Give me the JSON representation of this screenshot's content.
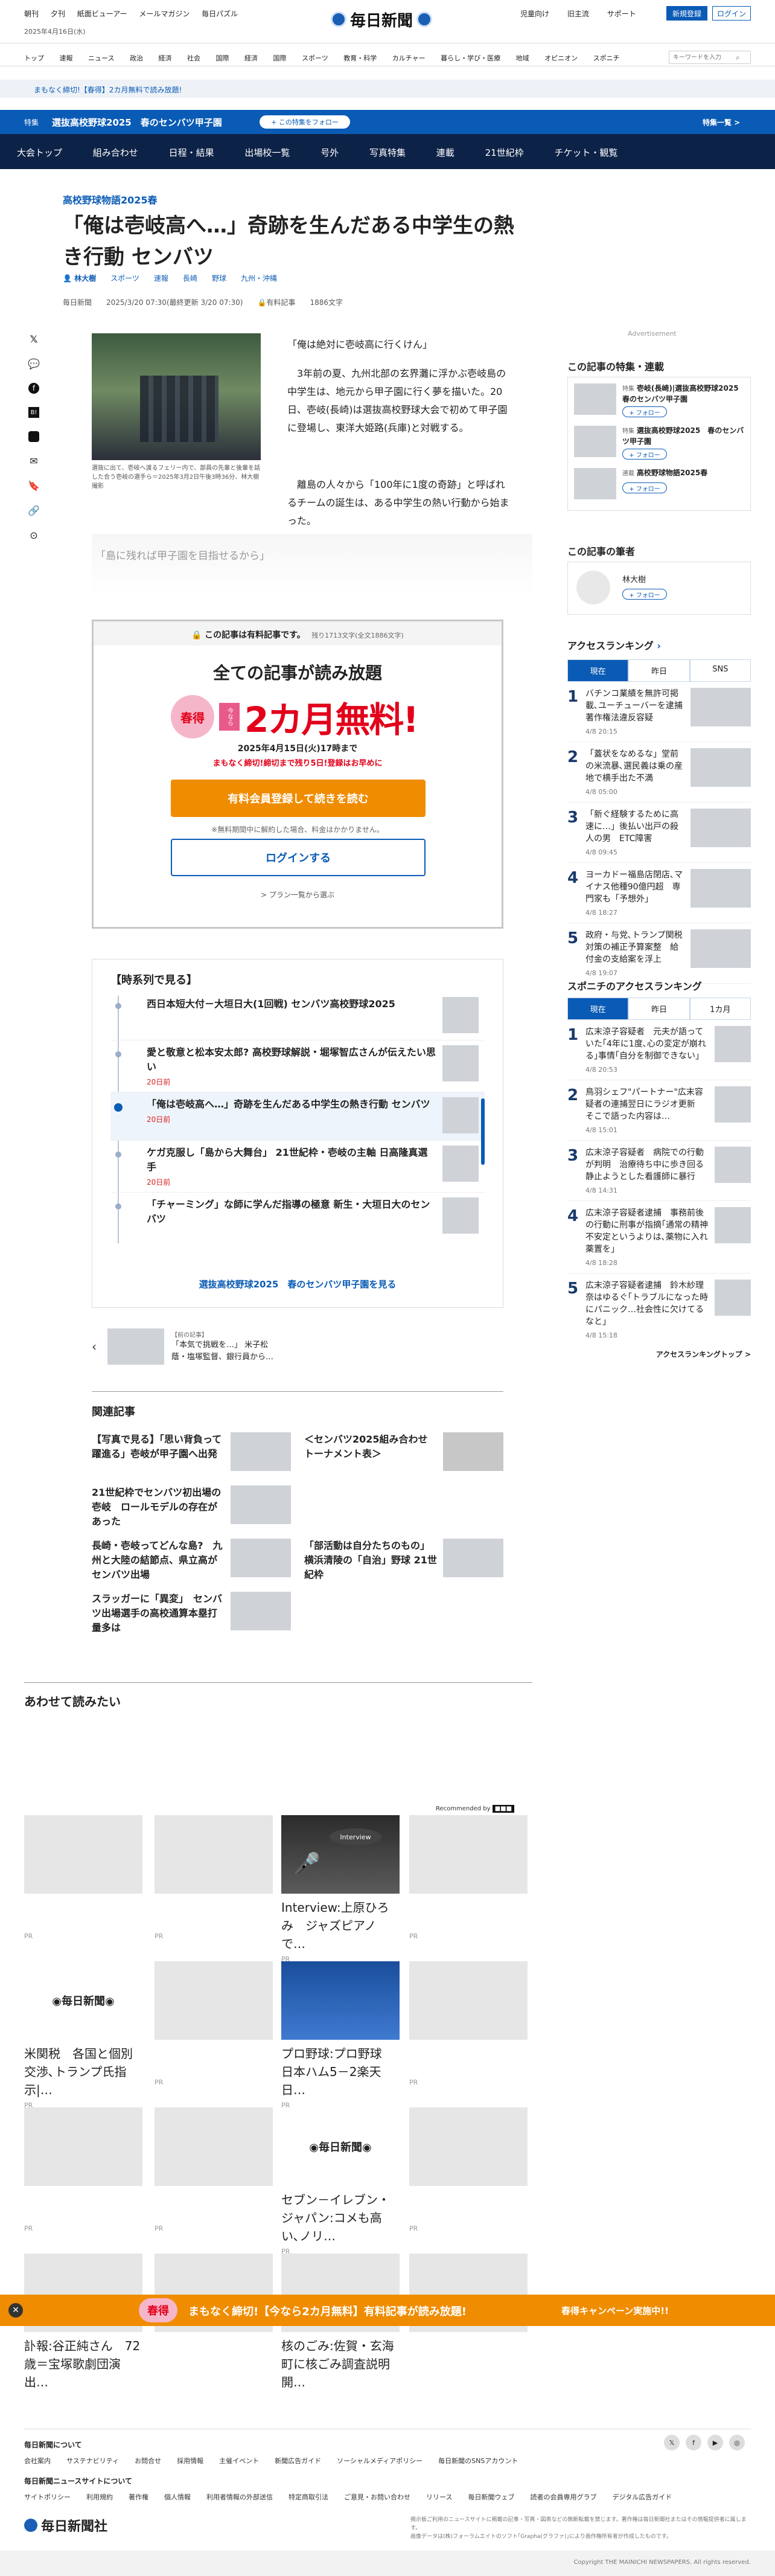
{
  "colors": {
    "navy": "#0d2247",
    "blue": "#0a5bb5",
    "orange": "#f08c00",
    "red": "#e2001a",
    "pink": "#e85a8a",
    "gold": "#f0c200",
    "blue_line": "#1a5fb4"
  },
  "header": {
    "left_links": [
      "朝刊",
      "夕刊",
      "紙面ビューアー",
      "メールマガジン",
      "毎日パズル"
    ],
    "date": "2025年4月16日(水)",
    "logo": "毎日新聞",
    "right_links": [
      "児童向け",
      "旧主流",
      "サポート"
    ],
    "register": "新規登録",
    "login": "ログイン"
  },
  "catnav": {
    "items": [
      "トップ",
      "速報",
      "ニュース",
      "政治",
      "経済",
      "社会",
      "国際",
      "経済",
      "国際",
      "スポーツ",
      "教育・科学",
      "カルチャー",
      "暮らし・学び・医療",
      "地域",
      "オピニオン",
      "スポニチ"
    ],
    "search_placeholder": "キーワードを入力"
  },
  "promo_bar": "まもなく締切!【春得】2カ月無料で読み放題!",
  "feature_bar": {
    "tag": "特集",
    "title": "選抜高校野球2025　春のセンバツ甲子園",
    "follow": "+ この特集をフォロー",
    "list": "特集一覧 >"
  },
  "subnav": [
    "大会トップ",
    "組み合わせ",
    "日程・結果",
    "出場校一覧",
    "号外",
    "写真特集",
    "連載",
    "21世紀枠",
    "チケット・観覧"
  ],
  "article": {
    "kicker": "高校野球物語2025春",
    "title": "「俺は壱岐高へ…」奇跡を生んだある中学生の熱き行動 センバツ",
    "byline": "林大樹",
    "tags": [
      "スポーツ",
      "速報",
      "長崎",
      "野球",
      "九州・沖縄"
    ],
    "meta": [
      "毎日新聞",
      "2025/3/20 07:30(最終更新 3/20 07:30)",
      "有料記事",
      "1886文字"
    ],
    "photo_caption": "選抜に出て、壱岐へ渡るフェリー内で、部員の先輩と後輩を話した合う壱岐の選手ら＝2025年3月2日午後3時36分、林大樹撮影",
    "p1": "「俺は絶対に壱岐高に行くけん」",
    "p2": "3年前の夏、九州北部の玄界灘に浮かぶ壱岐島の中学生は、地元から甲子園に行く夢を描いた。20日、壱岐(長崎)は選抜高校野球大会で初めて甲子園に登場し、東洋大姫路(兵庫)と対戦する。",
    "p3": "離島の人々から「100年に1度の奇跡」と呼ばれるチームの誕生は、ある中学生の熱い行動から始まった。",
    "teaser": "「島に残れば甲子園を目指せるから」"
  },
  "paywall": {
    "header": "この記事は有料記事です。",
    "remain": "残り1713文字(全文1886文字)",
    "headline": "全ての記事が読み放題",
    "badge_spring": "春",
    "badge_toku": "得",
    "badge_now": "今なら",
    "offer": "2カ月無料!",
    "deadline": "2025年4月15日(火)17時まで",
    "deadline_note": "まもなく締切!締切まで残り5日!登録はお早めに",
    "cta": "有料会員登録して続きを読む",
    "cta_note": "※無料期間中に解約した場合、料金はかかりません。",
    "login": "ログインする",
    "plans": "プラン一覧から選ぶ"
  },
  "series": {
    "title": "【時系列で見る】",
    "items": [
      {
        "title": "西日本短大付－大垣日大(1回戦) センバツ高校野球2025",
        "date": ""
      },
      {
        "title": "愛と敬意と松本安太郎? 高校野球解説・堀塚智広さんが伝えたい思い",
        "date": "20日前"
      },
      {
        "title": "「俺は壱岐高へ…」奇跡を生んだある中学生の熱き行動 センバツ",
        "date": "20日前"
      },
      {
        "title": "ケガ克服し「島から大舞台」 21世紀枠・壱岐の主軸 日高隆真選手",
        "date": "20日前"
      },
      {
        "title": "「チャーミング」な師に学んだ指導の極意 新生・大垣日大のセンバツ",
        "date": "20日前"
      }
    ],
    "more": "選抜高校野球2025　春のセンバツ甲子園を見る"
  },
  "prev": {
    "label": "【前の記事】",
    "title": "「本気で挑戦を…」 米子松蔭・塩塚監督、銀行員から…"
  },
  "related": {
    "title": "関連記事",
    "items": [
      "【写真で見る】「思い背負って躍進る」壱岐が甲子園へ出発",
      "＜センバツ2025組み合わせトーナメント表＞",
      "21世紀枠でセンバツ初出場の壱岐　ロールモデルの存在があった",
      "長崎・壱岐ってどんな島?　九州と大陸の結節点、県立高がセンバツ出場",
      "「部活動は自分たちのもの」 横浜清陵の「自治」野球 21世紀枠",
      "スラッガーに「異変」　センバツ出場選手の高校通算本塁打量多は"
    ]
  },
  "awasete": {
    "title": "あわせて読みたい",
    "recommended": "Recommended by",
    "cards": [
      {
        "title": "",
        "pr": "PR"
      },
      {
        "title": "",
        "pr": "PR"
      },
      {
        "title": "Interview:上原ひろみ　ジャズピアノで…",
        "pr": "PR"
      },
      {
        "title": "",
        "pr": "PR"
      },
      {
        "title": "米関税　各国と個別交渉､トランプ氏指示|…",
        "pr": "PR"
      },
      {
        "title": "",
        "pr": "PR"
      },
      {
        "title": "プロ野球:プロ野球　日本ハム5－2楽天　日…",
        "pr": "PR"
      },
      {
        "title": "",
        "pr": "PR"
      },
      {
        "title": "",
        "pr": "PR"
      },
      {
        "title": "",
        "pr": "PR"
      },
      {
        "title": "セブン－イレブン・ジャパン:コメも高い､ノリ…",
        "pr": "PR"
      },
      {
        "title": "",
        "pr": "PR"
      },
      {
        "title": "訃報:谷正純さん　72歳＝宝塚歌劇団演出…",
        "pr": "PR"
      },
      {
        "title": "",
        "pr": "PR"
      },
      {
        "title": "核のごみ:佐賀・玄海町に核ごみ調査説明開…",
        "pr": "PR"
      },
      {
        "title": "",
        "pr": "PR"
      }
    ],
    "interview": "Interview"
  },
  "sidebar": {
    "ad": "Advertisement",
    "feature_title": "この記事の特集・連載",
    "features": [
      {
        "label": "特集",
        "title": "壱岐(長崎)|選抜高校野球2025　春のセンバツ甲子園",
        "follow": "+ フォロー"
      },
      {
        "label": "特集",
        "title": "選抜高校野球2025　春のセンバツ甲子園",
        "follow": "+ フォロー"
      },
      {
        "label": "連載",
        "title": "高校野球物語2025春",
        "follow": "+ フォロー"
      }
    ],
    "author_title": "この記事の筆者",
    "author": "林大樹",
    "author_follow": "+ フォロー",
    "access_title": "アクセスランキング",
    "access_tabs": [
      "現在",
      "昨日",
      "SNS"
    ],
    "access": [
      {
        "t": "バチンコ業績を無許可掲載､ユーチューバーを逮捕　著作権法違反容疑",
        "d": "4/8 20:15"
      },
      {
        "t": "「蓋状をなめるな」堂前の米流暴､選民義は乗の産地で横手出た不満",
        "d": "4/8 05:00"
      },
      {
        "t": "「新ぐ経験するために高速に…」後払い出戸の殺人の男　ETC障害",
        "d": "4/8 09:45"
      },
      {
        "t": "ヨーカドー福島店閉店､マイナス他種90億円超　専門家も「予想外」",
        "d": "4/8 18:27"
      },
      {
        "t": "政府・与党､トランプ関税対策の補正予算案整　給付金の支給案を浮上",
        "d": "4/8 19:07"
      }
    ],
    "sponichi_title": "スポニチのアクセスランキング",
    "sponichi_tabs": [
      "現在",
      "昨日",
      "1カ月"
    ],
    "sponichi": [
      {
        "t": "広末涼子容疑者　元夫が語っていた｢4年に1度､心の変定が崩れる｣事情｢自分を制御できない｣",
        "d": "4/8 20:53"
      },
      {
        "t": "鳥羽シェフ\"パートナー\"広末容疑者の連捕翌日にラジオ更新　そこで語った内容は…",
        "d": "4/8 15:01"
      },
      {
        "t": "広末涼子容疑者　病院での行動が判明　治療待ち中に歩き回る静止ようとした看護師に暴行",
        "d": "4/8 14:31"
      },
      {
        "t": "広末涼子容疑者逮捕　事務前後の行動に刑事が指摘｢通常の精神不安定というよりは､薬物に入れ薬置を｣",
        "d": "4/8 18:28"
      },
      {
        "t": "広末涼子容疑者逮捕　鈴木紗理奈はゆるぐ｢トラブルになった時にパニック…社会性に欠けてるなと｣",
        "d": "4/8 15:18"
      }
    ],
    "sponichi_more": "アクセスランキングトップ >"
  },
  "footer": {
    "about_title": "毎日新聞について",
    "about": [
      "会社案内",
      "サステナビリティ",
      "お問合せ",
      "採用情報",
      "主催イベント",
      "新聞広告ガイド",
      "ソーシャルメディアポリシー",
      "毎日新聞のSNSアカウント"
    ],
    "site_title": "毎日新聞ニュースサイトについて",
    "site": [
      "サイトポリシー",
      "利用規約",
      "著作権",
      "個人情報",
      "利用者情報の外部送信",
      "特定商取引法",
      "ご意見・お問い合わせ",
      "リリース",
      "毎日新聞ウェブ",
      "読者の会員専用グラブ",
      "デジタル広告ガイド"
    ],
    "corp": "毎日新聞社",
    "notice": "掲示板ご利用のニュースサイトに掲載の記事・写真・図表などの無断転載を禁じます。著作権は毎日新聞社またはその情報提供者に属します。",
    "notice2": "画像データは(株)フォーラムエイトのソフト｢Grapha(グラファ)｣により画作権所有者が作成したものです。",
    "copyright": "Copyright THE MAINICHI NEWSPAPERS. All rights reserved."
  },
  "bottom_banner": {
    "badge": "春得",
    "text": "まもなく締切!【今なら2カ月無料】有料記事が読み放題!",
    "cta": "春得キャンペーン実施中!!"
  }
}
